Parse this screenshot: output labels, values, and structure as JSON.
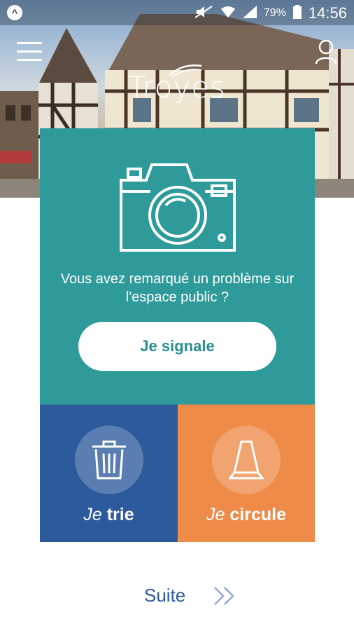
{
  "status_bar": {
    "battery_percent": "79%",
    "time": "14:56"
  },
  "header": {
    "logo_text": "Troyes"
  },
  "report_card": {
    "question": "Vous avez remarqué un problème sur l'espace public ?",
    "button_label": "Je signale"
  },
  "tiles": [
    {
      "prefix": "Je",
      "label": "trie",
      "icon": "trash-bin-icon",
      "color": "#2c5a9c"
    },
    {
      "prefix": "Je",
      "label": "circule",
      "icon": "traffic-cone-icon",
      "color": "#ef8b48"
    }
  ],
  "footer": {
    "next_label": "Suite",
    "next_icon": "double-chevron-right-icon"
  },
  "colors": {
    "teal": "#2e9a9a",
    "blue": "#2c5a9c",
    "orange": "#ef8b48"
  }
}
